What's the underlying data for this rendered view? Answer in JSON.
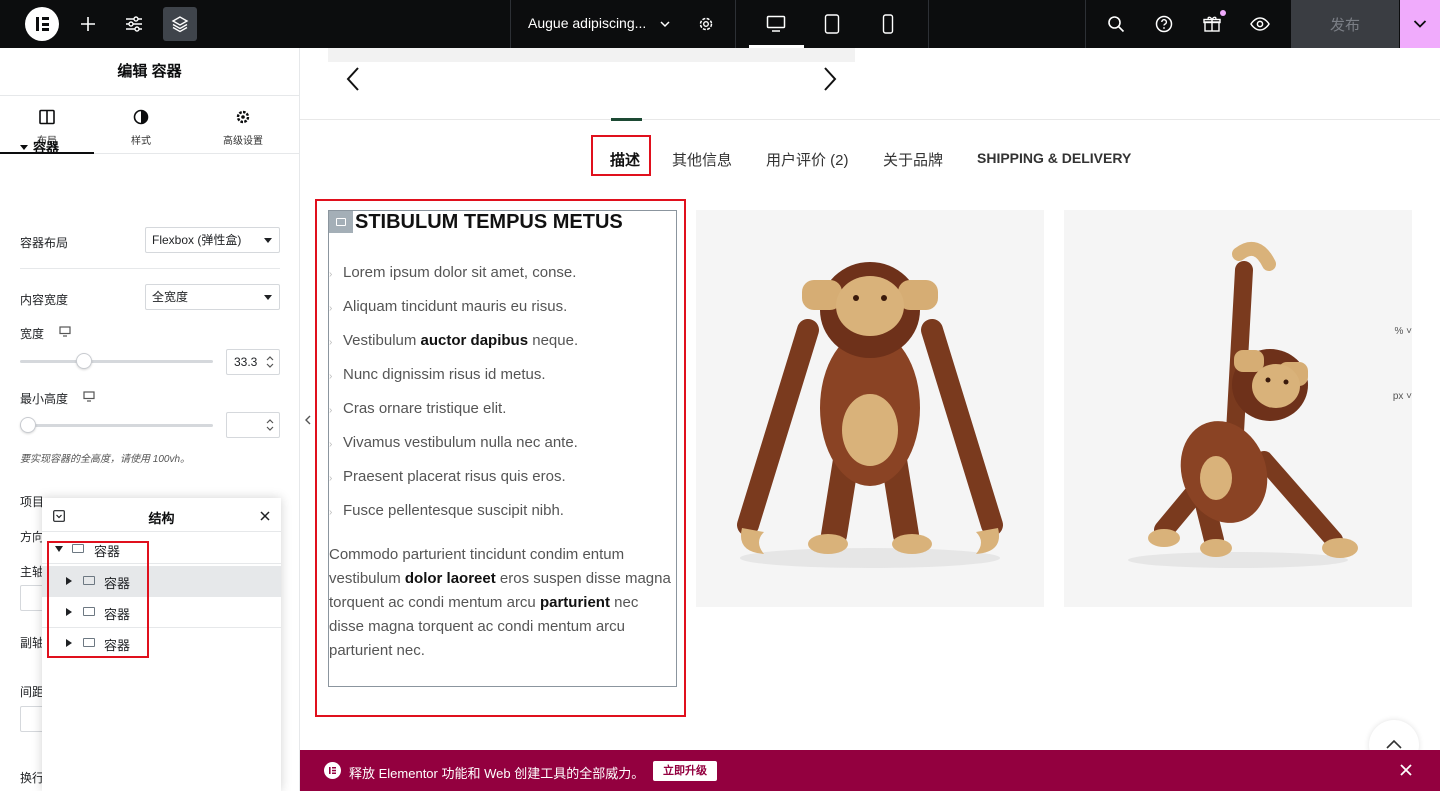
{
  "topbar": {
    "doc_title": "Augue adipiscing...",
    "publish_label": "发布"
  },
  "panel": {
    "header_title": "编辑 容器",
    "tabs": [
      {
        "label": "布局",
        "icon": "layout-icon"
      },
      {
        "label": "样式",
        "icon": "half-circle-icon"
      },
      {
        "label": "高级设置",
        "icon": "gear-icon"
      }
    ],
    "section_title": "容器",
    "container_layout": {
      "label": "容器布局",
      "value": "Flexbox (弹性盒)"
    },
    "content_width": {
      "label": "内容宽度",
      "value": "全宽度"
    },
    "width": {
      "label": "宽度",
      "unit": "%",
      "value": "33.3",
      "fraction": 0.333
    },
    "min_height": {
      "label": "最小高度",
      "unit": "px",
      "value": "",
      "fraction": 0
    },
    "hint": "要实现容器的全高度，请使用 100vh。",
    "partial_labels": [
      "项目",
      "方向",
      "主轴",
      "副轴",
      "间距",
      "换行"
    ]
  },
  "structure": {
    "title": "结构",
    "root": "容器",
    "children": [
      "容器",
      "容器",
      "容器"
    ]
  },
  "canvas": {
    "tabs": [
      {
        "label": "描述",
        "active": true
      },
      {
        "label": "其他信息"
      },
      {
        "label": "用户评价 (2)"
      },
      {
        "label": "关于品牌"
      },
      {
        "label": "SHIPPING & DELIVERY"
      }
    ],
    "desc_title": "STIBULUM TEMPUS METUS",
    "list": [
      {
        "text": "Lorem ipsum dolor sit amet, conse."
      },
      {
        "text": "Aliquam tincidunt mauris eu risus."
      },
      {
        "pre": "Vestibulum ",
        "bold": "auctor dapibus",
        "post": " neque."
      },
      {
        "text": "Nunc dignissim risus id metus."
      },
      {
        "text": "Cras ornare tristique elit."
      },
      {
        "text": "Vivamus vestibulum nulla nec ante."
      },
      {
        "text": "Praesent placerat risus quis eros."
      },
      {
        "text": "Fusce pellentesque suscipit nibh."
      }
    ],
    "para": {
      "p1": "Commodo parturient tincidunt condim entum vestibulum ",
      "b1": "dolor laoreet",
      "p2": " eros suspen disse magna torquent ac condi mentum arcu ",
      "b2": "parturient",
      "p3": " nec disse magna torquent ac condi mentum arcu parturient nec."
    }
  },
  "promo": {
    "text": "释放 Elementor 功能和 Web 创建工具的全部威力。",
    "button": "立即升级"
  }
}
